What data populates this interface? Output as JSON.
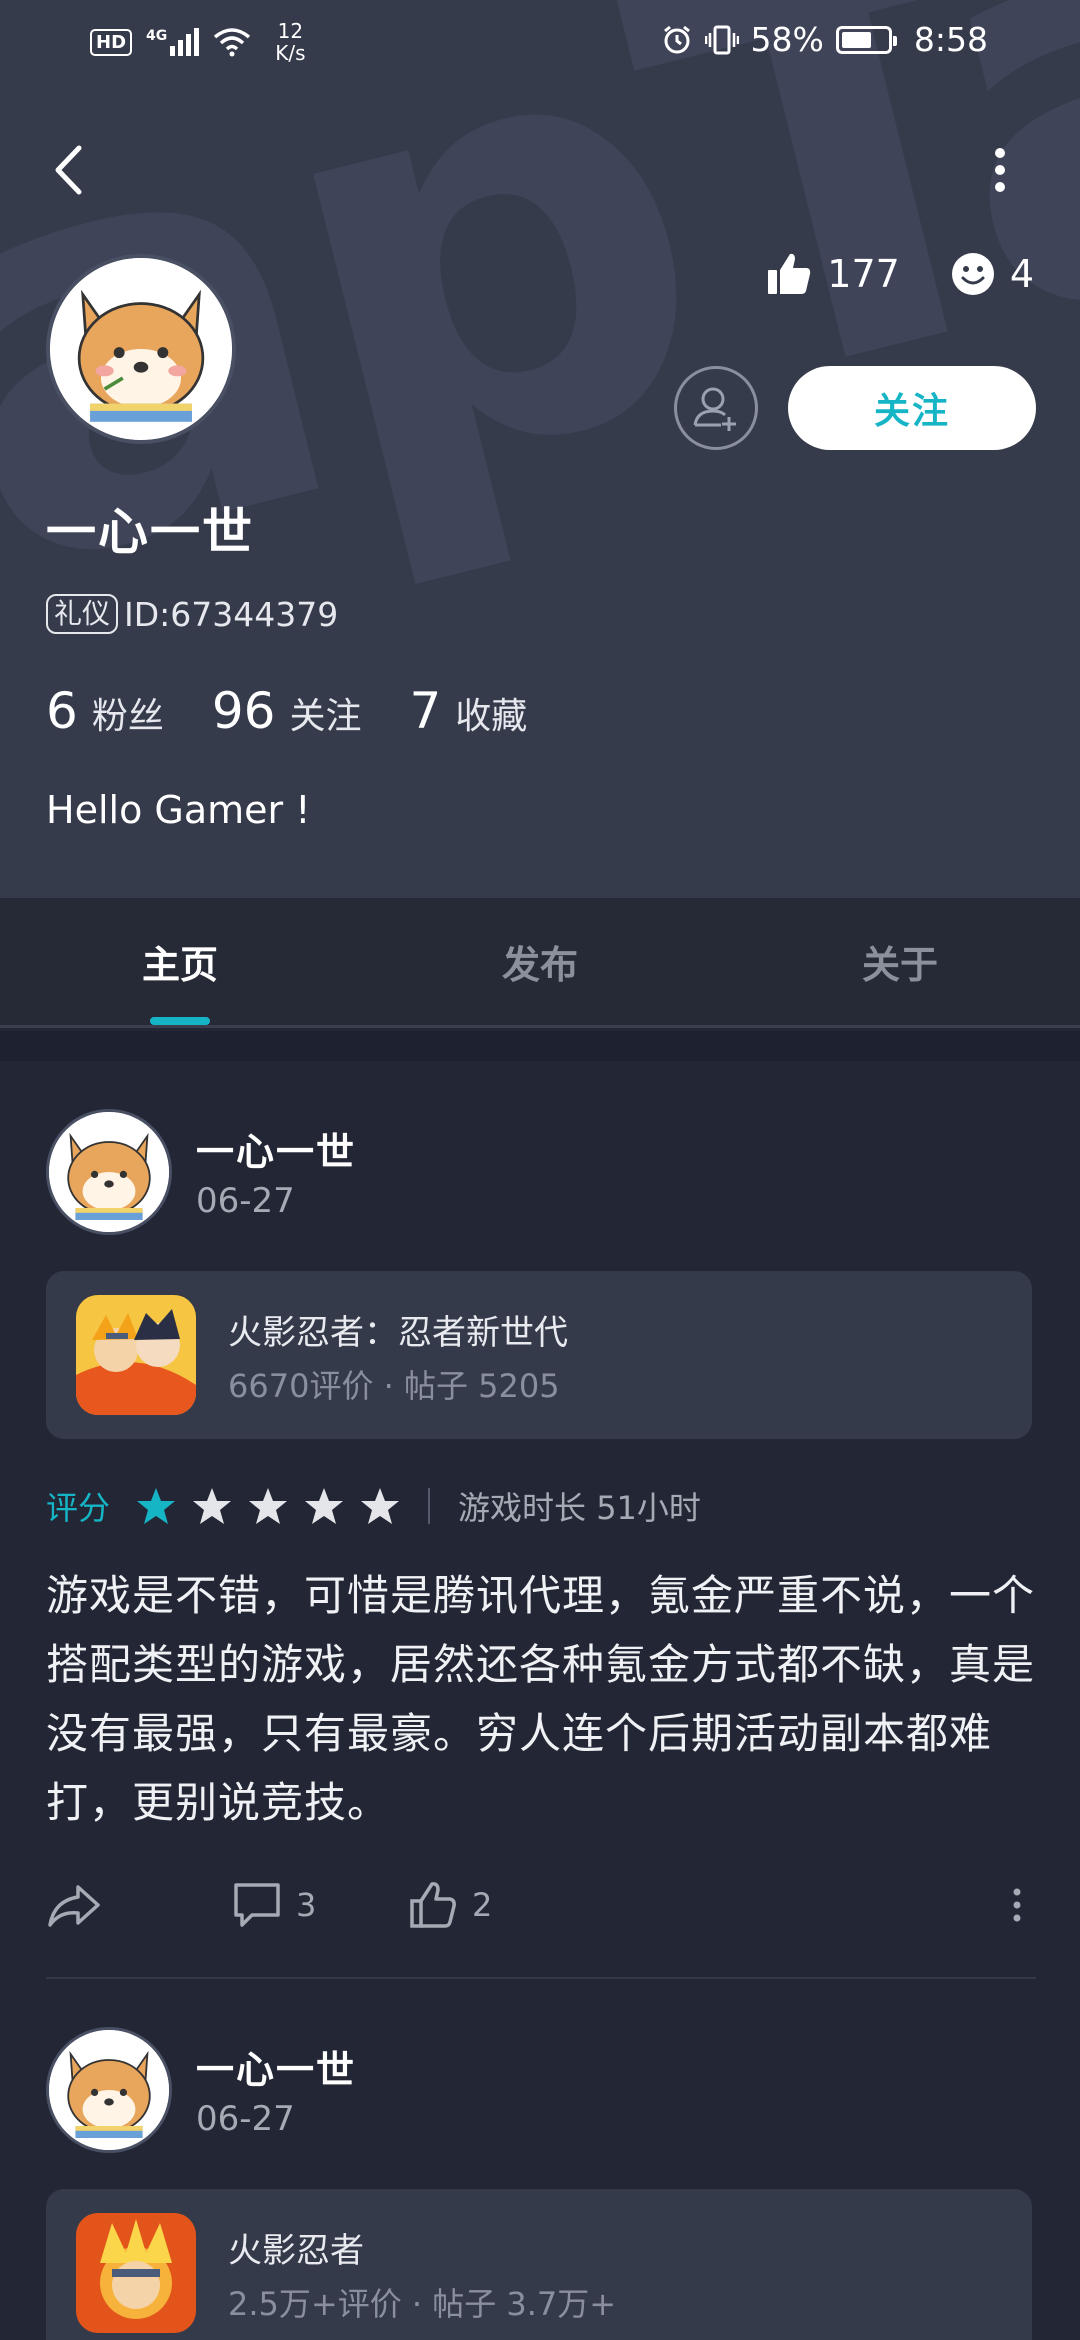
{
  "status_bar": {
    "hd": "HD",
    "network": "4G",
    "speed_value": "12",
    "speed_unit": "K/s",
    "battery": "58%",
    "time": "8:58"
  },
  "profile": {
    "like_count": "177",
    "emoji_count": "4",
    "follow_label": "关注",
    "username": "一心一世",
    "badge": "礼仪",
    "id_text": "ID:67344379",
    "fans_num": "6",
    "fans_label": "粉丝",
    "following_num": "96",
    "following_label": "关注",
    "favorites_num": "7",
    "favorites_label": "收藏",
    "bio": "Hello Gamer !"
  },
  "tabs": [
    {
      "label": "主页",
      "active": true
    },
    {
      "label": "发布",
      "active": false
    },
    {
      "label": "关于",
      "active": false
    }
  ],
  "posts": [
    {
      "author": "一心一世",
      "date": "06-27",
      "game_name": "火影忍者：忍者新世代",
      "game_meta": "6670评价 · 帖子 5205",
      "rating_label": "评分",
      "rating": 1,
      "playtime": "游戏时长 51小时",
      "body": "游戏是不错，可惜是腾讯代理，氪金严重不说，一个搭配类型的游戏，居然还各种氪金方式都不缺，真是没有最强，只有最豪。穷人连个后期活动副本都难打，更别说竞技。",
      "comments": "3",
      "likes": "2"
    },
    {
      "author": "一心一世",
      "date": "06-27",
      "game_name": "火影忍者",
      "game_meta": "2.5万+评价 · 帖子 3.7万+"
    }
  ],
  "colors": {
    "accent": "#16b5c6",
    "header_bg": "#363b4b",
    "page_bg": "#232735",
    "card_bg": "#353a4a"
  }
}
